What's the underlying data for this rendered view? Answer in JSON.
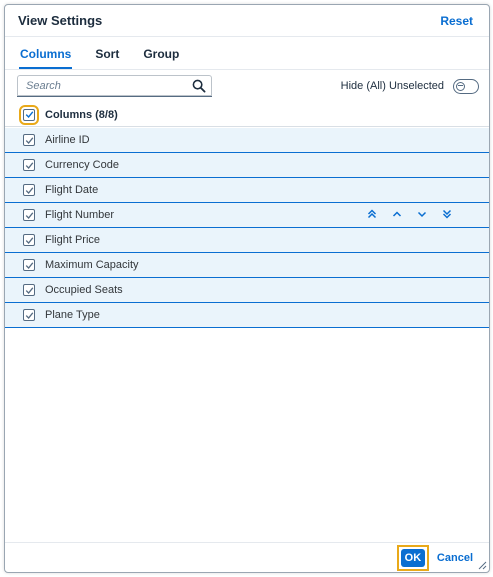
{
  "dialog": {
    "title": "View Settings",
    "reset_label": "Reset"
  },
  "tabs": [
    {
      "label": "Columns",
      "active": true
    },
    {
      "label": "Sort",
      "active": false
    },
    {
      "label": "Group",
      "active": false
    }
  ],
  "toolbar": {
    "search_placeholder": "Search",
    "search_value": "",
    "search_icon": "search-icon",
    "hide_unselected_label": "Hide (All) Unselected",
    "hide_unselected_on": false
  },
  "list": {
    "header_label": "Columns (8/8)",
    "header_checked": true,
    "items": [
      {
        "label": "Airline ID",
        "checked": true
      },
      {
        "label": "Currency Code",
        "checked": true
      },
      {
        "label": "Flight Date",
        "checked": true
      },
      {
        "label": "Flight Number",
        "checked": true,
        "show_movers": true
      },
      {
        "label": "Flight Price",
        "checked": true
      },
      {
        "label": "Maximum Capacity",
        "checked": true
      },
      {
        "label": "Occupied Seats",
        "checked": true
      },
      {
        "label": "Plane Type",
        "checked": true
      }
    ],
    "movers": [
      "move-to-top-icon",
      "move-up-icon",
      "move-down-icon",
      "move-to-bottom-icon"
    ]
  },
  "footer": {
    "ok_label": "OK",
    "cancel_label": "Cancel"
  },
  "colors": {
    "accent": "#0a6ed1",
    "row_selected_bg": "#eaf4fb",
    "highlight": "#e9a919"
  }
}
